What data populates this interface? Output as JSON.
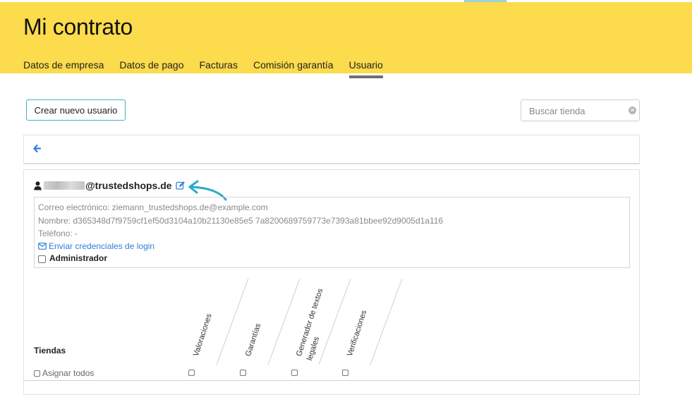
{
  "header": {
    "title": "Mi contrato",
    "tabs": [
      {
        "label": "Datos de empresa"
      },
      {
        "label": "Datos de pago"
      },
      {
        "label": "Facturas"
      },
      {
        "label": "Comisión garantía"
      },
      {
        "label": "Usuario",
        "active": true
      }
    ]
  },
  "toolbar": {
    "new_user_label": "Crear nuevo usuario",
    "search_placeholder": "Buscar tienda",
    "search_value": ""
  },
  "user": {
    "email_visible": "@trustedshops.de",
    "info": {
      "email": "Correo electrónico: ziemann_trustedshops.de@example.com",
      "name": "Nombre: d365348d7f9759cf1ef50d3104a10b21130e85e5 7a8200689759773e7393a81bbee92d9005d1a116",
      "phone": "Teléfono: -",
      "send_credentials": "Enviar credenciales de login",
      "admin_label": "Administrador",
      "admin_checked": false
    }
  },
  "permissions": {
    "shops_label": "Tiendas",
    "assign_all_label": "Asignar todos",
    "columns": [
      {
        "label": "Valoraciones"
      },
      {
        "label": "Garantías"
      },
      {
        "label": "Generador de textos",
        "label2": "legales"
      },
      {
        "label": "Verificaciones"
      }
    ]
  },
  "colors": {
    "header_bg": "#fcdb4c",
    "accent_border": "#41b3c4",
    "link": "#2f7fd8",
    "annotation_arrow": "#29a9c9"
  },
  "icons": {
    "back": "arrow-left-icon",
    "user": "user-icon",
    "edit": "edit-icon",
    "mail": "envelope-icon",
    "clear": "clear-circle-icon"
  }
}
